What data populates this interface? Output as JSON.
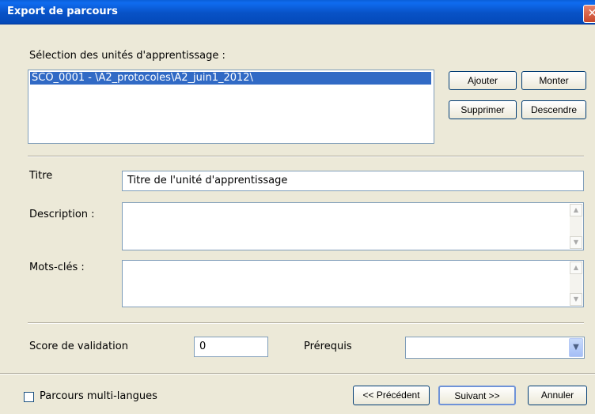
{
  "window": {
    "title": "Export de parcours",
    "close_glyph": "✕"
  },
  "selection": {
    "label": "Sélection des unités d'apprentissage :",
    "items": [
      "SCO_0001 - \\A2_protocoles\\A2_juin1_2012\\"
    ]
  },
  "buttons": {
    "ajouter": "Ajouter",
    "monter": "Monter",
    "supprimer": "Supprimer",
    "descendre": "Descendre",
    "precedent": "<< Précédent",
    "suivant": "Suivant >>",
    "annuler": "Annuler"
  },
  "form": {
    "titre_label": "Titre",
    "titre_value": "Titre de l'unité d'apprentissage",
    "description_label": "Description :",
    "description_value": "",
    "mots_cles_label": "Mots-clés :",
    "mots_cles_value": "",
    "score_label": "Score de validation",
    "score_value": "0",
    "prerequis_label": "Prérequis",
    "prerequis_value": ""
  },
  "footer": {
    "multilang_label": "Parcours multi-langues",
    "multilang_checked": false
  },
  "icons": {
    "scroll_up": "chevron-up-icon",
    "scroll_down": "chevron-down-icon",
    "dropdown": "chevron-down-icon"
  },
  "colors": {
    "title_bar": "#0852c6",
    "selection": "#316ac5",
    "dialog_bg": "#ece9d8"
  }
}
